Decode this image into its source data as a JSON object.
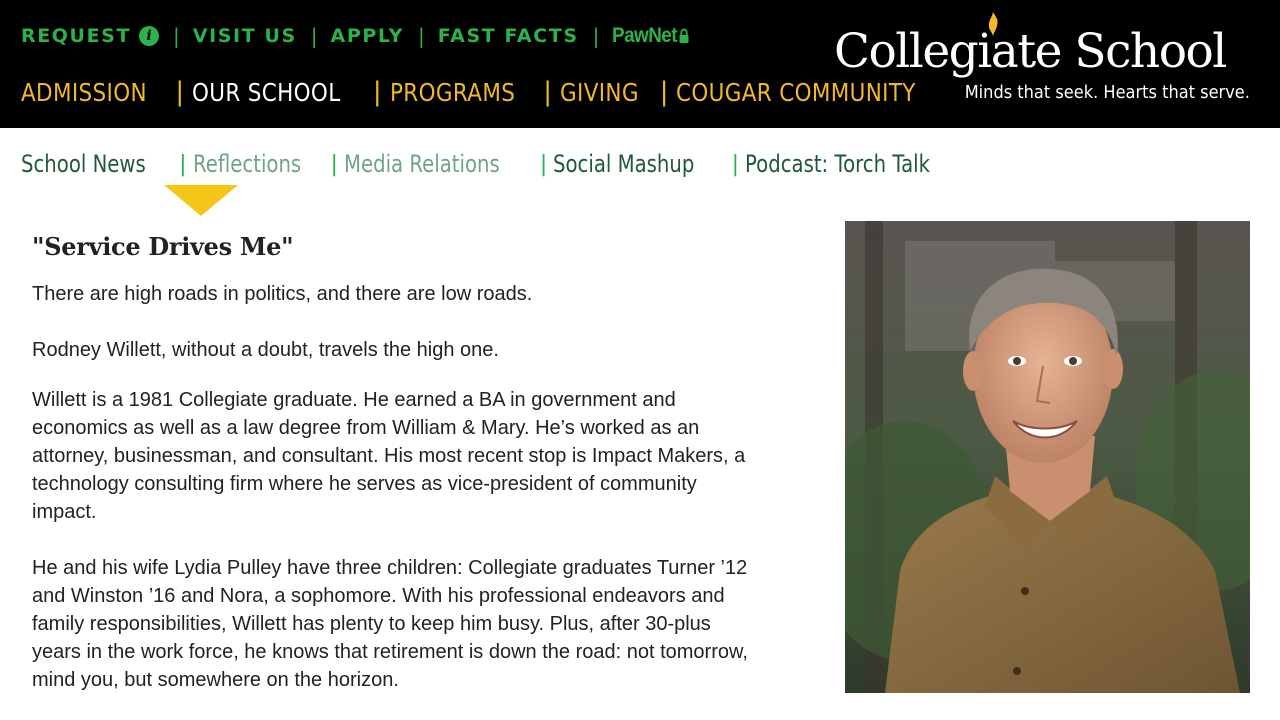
{
  "utility_nav": {
    "request": "REQUEST",
    "request_info_icon": "i",
    "visit": "VISIT US",
    "apply": "APPLY",
    "fast_facts": "FAST FACTS",
    "pawnet": "PawNet",
    "separator": "|"
  },
  "main_nav": {
    "items": [
      "ADMISSION",
      "OUR SCHOOL",
      "PROGRAMS",
      "GIVING",
      "COUGAR COMMUNITY"
    ],
    "active": "OUR SCHOOL",
    "separator": "|"
  },
  "logo": {
    "name": "Collegiate School",
    "tagline": "Minds that seek. Hearts that serve."
  },
  "sub_nav": {
    "items": [
      "School News",
      "Reflections",
      "Media Relations",
      "Social Mashup",
      "Podcast: Torch Talk"
    ],
    "active": "Reflections",
    "separator": "|"
  },
  "article": {
    "title": "\"Service Drives Me\"",
    "paragraphs": [
      "There are high roads in politics, and there are low roads.",
      "Rodney Willett, without a doubt, travels the high one.",
      "Willett is a 1981 Collegiate graduate. He earned a BA in government and economics as well as a law degree from William & Mary. He’s worked as an attorney, businessman, and consultant. His most recent stop is Impact Makers, a technology consulting firm where he serves as vice-president of community impact.",
      "He and his wife Lydia Pulley have three children: Collegiate graduates Turner ’12 and Winston ’16 and Nora, a sophomore. With his professional endeavors and family responsibilities, Willett has plenty to keep him busy. Plus, after 30-plus years in the work force, he knows that retirement is down the road: not tomorrow, mind you, but somewhere on the horizon."
    ]
  },
  "colors": {
    "header_bg": "#000000",
    "utility_green": "#2bb24c",
    "nav_gold": "#f2b82b",
    "sub_nav_dark_green": "#1f5a36",
    "sub_nav_muted_green": "#6fa583",
    "arrow_yellow": "#f5c518"
  },
  "icons": {
    "request_info": "info-icon",
    "pawnet_lock": "lock-icon",
    "logo_flame": "flame-icon",
    "active_indicator": "triangle-down-icon"
  }
}
